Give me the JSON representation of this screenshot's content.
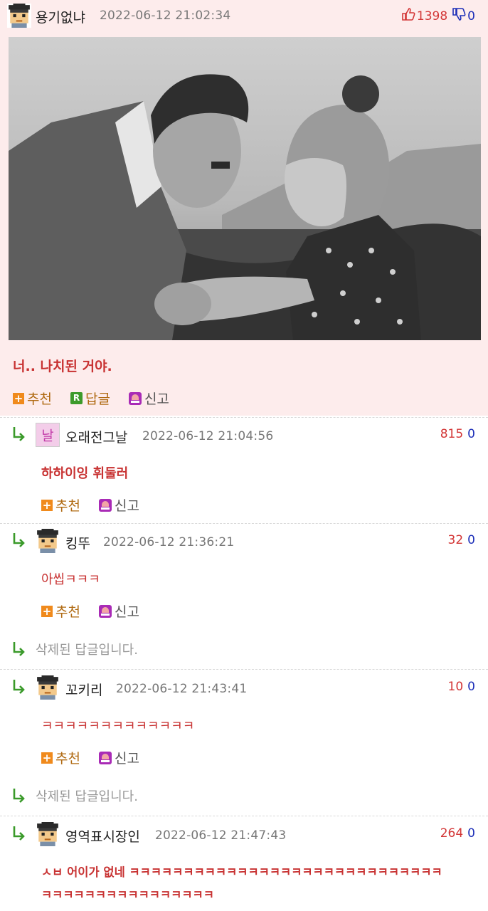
{
  "post": {
    "author": "용기없냐",
    "date": "2022-06-12 21:02:34",
    "upvotes": "1398",
    "downvotes": "0",
    "text": "너.. 나치된 거야.",
    "actions": {
      "recommend": "추천",
      "reply": "답글",
      "report": "신고"
    }
  },
  "comments": [
    {
      "author": "오래전그날",
      "date": "2022-06-12 21:04:56",
      "up": "815",
      "down": "0",
      "text": "하하이잉 휘둘러",
      "recommend": "추천",
      "report": "신고"
    },
    {
      "author": "킹뚜",
      "date": "2022-06-12 21:36:21",
      "up": "32",
      "down": "0",
      "text": "아씹ㅋㅋㅋ",
      "recommend": "추천",
      "report": "신고"
    },
    {
      "author": "꼬키리",
      "date": "2022-06-12 21:43:41",
      "up": "10",
      "down": "0",
      "text": "ㅋㅋㅋㅋㅋㅋㅋㅋㅋㅋㅋㅋㅋ",
      "recommend": "추천",
      "report": "신고"
    },
    {
      "author": "영역표시장인",
      "date": "2022-06-12 21:47:43",
      "up": "264",
      "down": "0",
      "text_line1": "ㅅㅂ 어이가 없네 ㅋㅋㅋㅋㅋㅋㅋㅋㅋㅋㅋㅋㅋㅋㅋㅋㅋㅋㅋㅋㅋㅋㅋㅋㅋㅋㅋㅋㅋ",
      "text_line2": "ㅋㅋㅋㅋㅋㅋㅋㅋㅋㅋㅋㅋㅋㅋㅋㅋ"
    }
  ],
  "deleted_reply": "삭제된 답글입니다.",
  "colors": {
    "post_bg": "#fdecec",
    "upvote": "#d33636",
    "downvote": "#1d2fb8",
    "comment_text": "#c83232",
    "action_text": "#b06a12"
  },
  "icons": [
    "thumbs-up-icon",
    "thumbs-down-icon",
    "plus-icon",
    "reply-r-icon",
    "siren-icon",
    "reply-arrow-icon",
    "pixel-avatar-icon"
  ]
}
